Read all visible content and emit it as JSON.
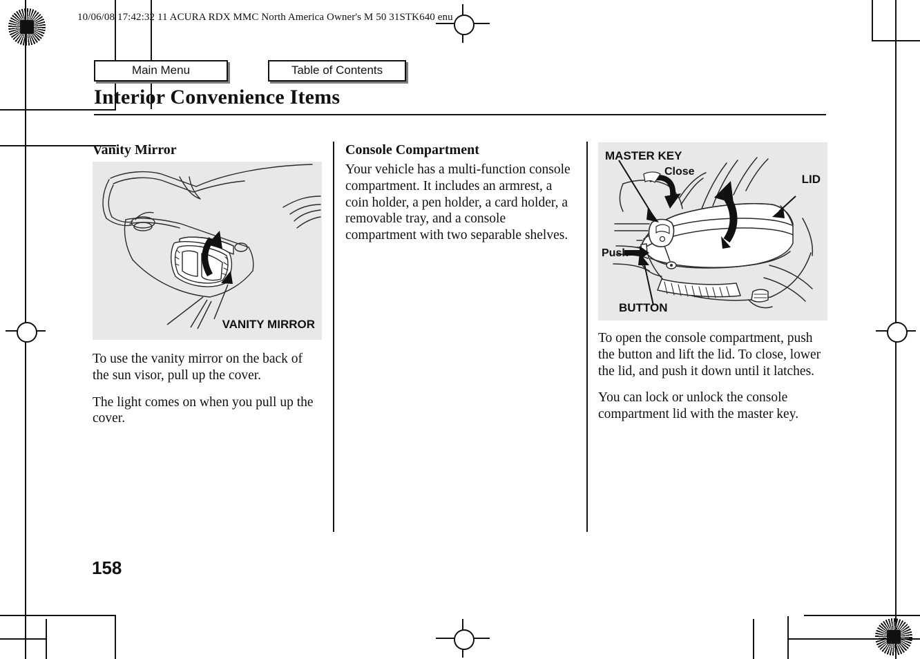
{
  "header": {
    "stamp": "10/06/08 17:42:32   11 ACURA RDX MMC North America Owner's M 50 31STK640 enu"
  },
  "nav": {
    "main_menu": "Main Menu",
    "table_of_contents": "Table of Contents"
  },
  "page": {
    "title": "Interior Convenience Items",
    "number": "158"
  },
  "columns": {
    "left": {
      "heading": "Vanity Mirror",
      "figure_label": "VANITY MIRROR",
      "paragraphs": [
        "To use the vanity mirror on the back of the sun visor, pull up the cover.",
        "The light comes on when you pull up the cover."
      ]
    },
    "middle": {
      "heading": "Console Compartment",
      "paragraphs": [
        "Your vehicle has a multi-function console compartment. It includes an armrest, a coin holder, a pen holder, a card holder, a removable tray, and a console compartment with two separable shelves."
      ]
    },
    "right": {
      "figure_labels": {
        "master_key": "MASTER KEY",
        "close": "Close",
        "lid": "LID",
        "push": "Push",
        "button": "BUTTON"
      },
      "paragraphs": [
        "To open the console compartment, push the button and lift the lid. To close, lower the lid, and push it down until it latches.",
        "You can lock or unlock the console compartment lid with the master key."
      ]
    }
  },
  "colors": {
    "figure_background": "#e8e8e8",
    "ink": "#111111",
    "paper": "#ffffff",
    "button_shadow": "#7d7d7d"
  }
}
